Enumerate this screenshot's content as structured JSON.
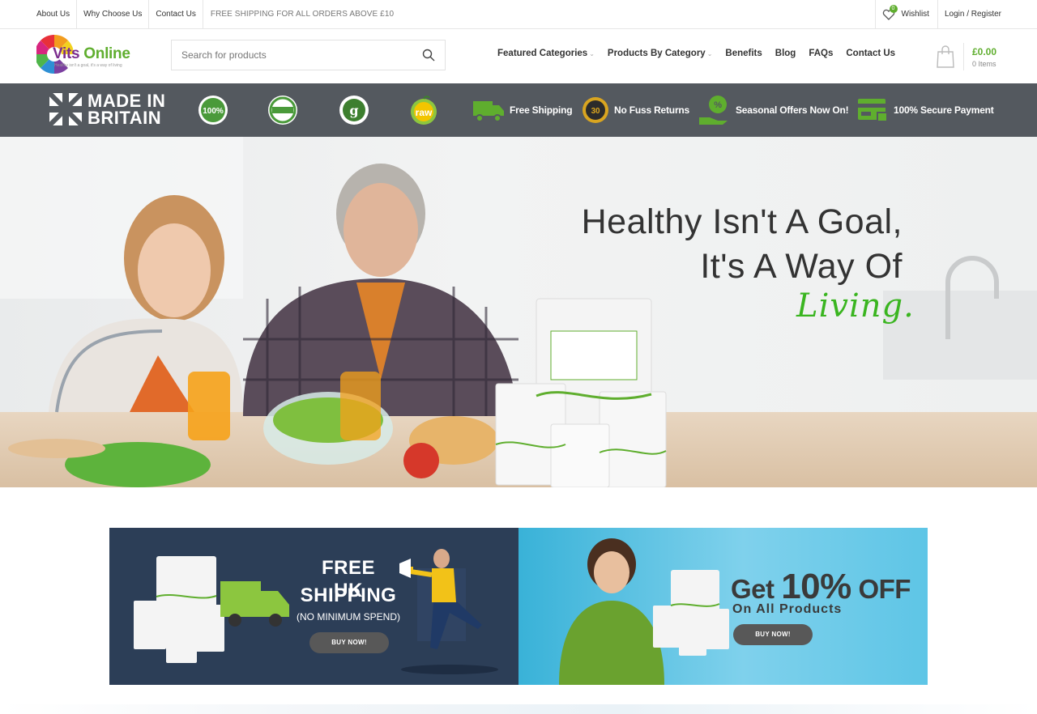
{
  "topbar": {
    "links": [
      "About Us",
      "Why Choose Us",
      "Contact Us"
    ],
    "promo": "FREE SHIPPING FOR ALL ORDERS ABOVE £10",
    "wishlist_label": "Wishlist",
    "wishlist_count": "0",
    "login_label": "Login / Register"
  },
  "header": {
    "logo_word1": "Vits",
    "logo_word2": "Online",
    "logo_tagline": "Healthy isn't a goal, it's a way of living",
    "search_placeholder": "Search for products",
    "nav": [
      {
        "label": "Featured Categories",
        "has_dropdown": true
      },
      {
        "label": "Products By Category",
        "has_dropdown": true
      },
      {
        "label": "Benefits",
        "has_dropdown": false
      },
      {
        "label": "Blog",
        "has_dropdown": false
      },
      {
        "label": "FAQs",
        "has_dropdown": false
      },
      {
        "label": "Contact Us",
        "has_dropdown": false
      }
    ],
    "cart_total": "£0.00",
    "cart_items": "0 Items"
  },
  "strip": {
    "made_in_line1": "MADE IN",
    "made_in_line2": "BRITAIN",
    "badges": [
      "100% ORGANIC",
      "100% PURE",
      "ORGANIC FOOD",
      "raw"
    ],
    "features": [
      "Free Shipping",
      "No Fuss Returns",
      "Seasonal Offers Now On!",
      "100% Secure Payment"
    ]
  },
  "hero": {
    "line1": "Healthy Isn't A Goal,",
    "line2": "It's A Way Of",
    "script_word": "Living."
  },
  "banners": {
    "shipping_line1": "FREE UK",
    "shipping_line2": "SHIPPING",
    "shipping_sub": "(NO MINIMUM SPEND)",
    "shipping_button": "BUY NOW!",
    "discount_get": "Get",
    "discount_amount": "10%",
    "discount_off": "OFF",
    "discount_sub": "On All Products",
    "discount_button": "BUY NOW!"
  },
  "colors": {
    "accent_green": "#5fae2e",
    "strip_grey": "#54595f",
    "banner_navy": "#2c3e57",
    "banner_blue": "#39b2d8"
  }
}
